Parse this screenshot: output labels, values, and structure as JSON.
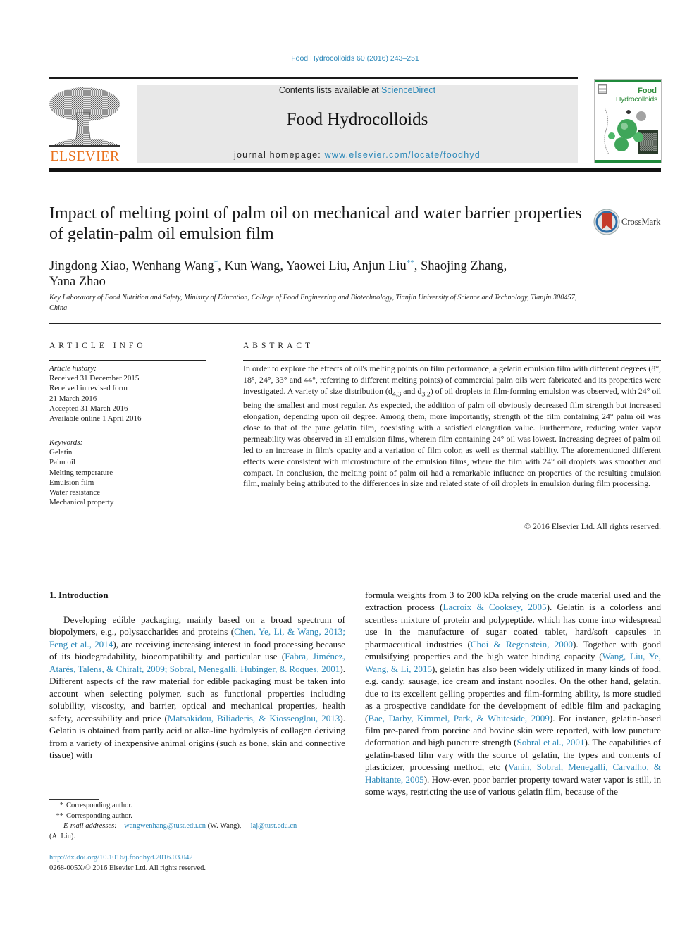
{
  "header": {
    "citation": "Food Hydrocolloids 60 (2016) 243–251",
    "contents_prefix": "Contents lists available at ",
    "contents_link": "ScienceDirect",
    "journal_title": "Food Hydrocolloids",
    "homepage_prefix": "journal homepage: ",
    "homepage_link": "www.elsevier.com/locate/foodhyd",
    "publisher_logo_text": "ELSEVIER",
    "cover_title_line1": "Food",
    "cover_title_line2": "Hydrocolloids",
    "crossmark_label": "CrossMark"
  },
  "article": {
    "title": "Impact of melting point of palm oil on mechanical and water barrier properties of gelatin-palm oil emulsion film",
    "authors": [
      {
        "name": "Jingdong Xiao",
        "mark": ""
      },
      {
        "name": "Wenhang Wang",
        "mark": "*"
      },
      {
        "name": "Kun Wang",
        "mark": ""
      },
      {
        "name": "Yaowei Liu",
        "mark": ""
      },
      {
        "name": "Anjun Liu",
        "mark": "**"
      },
      {
        "name": "Shaojing Zhang",
        "mark": ""
      },
      {
        "name": "Yana Zhao",
        "mark": ""
      }
    ],
    "affiliation": "Key Laboratory of Food Nutrition and Safety, Ministry of Education, College of Food Engineering and Biotechnology, Tianjin University of Science and Technology, Tianjin 300457, China"
  },
  "article_info": {
    "heading": "ARTICLE INFO",
    "history_label": "Article history:",
    "history": [
      "Received 31 December 2015",
      "Received in revised form",
      "21 March 2016",
      "Accepted 31 March 2016",
      "Available online 1 April 2016"
    ],
    "keywords_label": "Keywords:",
    "keywords": [
      "Gelatin",
      "Palm oil",
      "Melting temperature",
      "Emulsion film",
      "Water resistance",
      "Mechanical property"
    ]
  },
  "abstract": {
    "heading": "ABSTRACT",
    "text_part1": "In order to explore the effects of oil's melting points on film performance, a gelatin emulsion film with different degrees (8°, 18°, 24°, 33° and 44°, referring to different melting points) of commercial palm oils were fabricated and its properties were investigated. A variety of size distribution (d",
    "sub1": "4,3",
    "text_part2": " and d",
    "sub2": "3,2",
    "text_part3": ") of oil droplets in film-forming emulsion was observed, with 24° oil being the smallest and most regular. As expected, the addition of palm oil obviously decreased film strength but increased elongation, depending upon oil degree. Among them, more importantly, strength of the film containing 24° palm oil was close to that of the pure gelatin film, coexisting with a satisfied elongation value. Furthermore, reducing water vapor permeability was observed in all emulsion films, wherein film containing 24° oil was lowest. Increasing degrees of palm oil led to an increase in film's opacity and a variation of film color, as well as thermal stability. The aforementioned different effects were consistent with microstructure of the emulsion films, where the film with 24° oil droplets was smoother and compact. In conclusion, the melting point of palm oil had a remarkable influence on properties of the resulting emulsion film, mainly being attributed to the differences in size and related state of oil droplets in emulsion during film processing.",
    "copyright": "© 2016 Elsevier Ltd. All rights reserved."
  },
  "intro": {
    "heading": "1.  Introduction",
    "left": [
      {
        "t": "Developing edible packaging, mainly based on a broad spectrum of biopolymers, e.g., polysaccharides and proteins ("
      },
      {
        "l": "Chen, Ye, Li, & Wang, 2013; Feng et al., 2014"
      },
      {
        "t": "), are receiving increasing interest in food processing because of its biodegradability, biocompatibility and particular use ("
      },
      {
        "l": "Fabra, Jiménez, Atarés, Talens, & Chiralt, 2009; Sobral, Menegalli, Hubinger, & Roques, 2001"
      },
      {
        "t": "). Different aspects of the raw material for edible packaging must be taken into account when selecting polymer, such as functional properties including solubility, viscosity, and barrier, optical and mechanical properties, health safety, accessibility and price ("
      },
      {
        "l": "Matsakidou, Biliaderis, & Kiosseoglou, 2013"
      },
      {
        "t": "). Gelatin is obtained from partly acid or alka-line hydrolysis of collagen deriving from a variety of inexpensive animal origins (such as bone, skin and connective tissue) with"
      }
    ],
    "right": [
      {
        "t": "formula weights from 3 to 200 kDa relying on the crude material used and the extraction process ("
      },
      {
        "l": "Lacroix & Cooksey, 2005"
      },
      {
        "t": "). Gelatin is a colorless and scentless mixture of protein and polypeptide, which has come into widespread use in the manufacture of sugar coated tablet, hard/soft capsules in pharmaceutical industries ("
      },
      {
        "l": "Choi & Regenstein, 2000"
      },
      {
        "t": "). Together with good emulsifying properties and the high water binding capacity ("
      },
      {
        "l": "Wang, Liu, Ye, Wang, & Li, 2015"
      },
      {
        "t": "), gelatin has also been widely utilized in many kinds of food, e.g. candy, sausage, ice cream and instant noodles. On the other hand, gelatin, due to its excellent gelling properties and film-forming ability, is more studied as a prospective candidate for the development of edible film and packaging ("
      },
      {
        "l": "Bae, Darby, Kimmel, Park, & Whiteside, 2009"
      },
      {
        "t": "). For instance, gelatin-based film pre-pared from porcine and bovine skin were reported, with low puncture deformation and high puncture strength ("
      },
      {
        "l": "Sobral et al., 2001"
      },
      {
        "t": "). The capabilities of gelatin-based film vary with the source of gelatin, the types and contents of plasticizer, processing method, etc ("
      },
      {
        "l": "Vanin, Sobral, Menegalli, Carvalho, & Habitante, 2005"
      },
      {
        "t": "). How-ever, poor barrier property toward water vapor is still, in some ways, restricting the use of various gelatin film, because of the"
      }
    ]
  },
  "footnotes": {
    "fn1_mark": "*",
    "fn1_text": "Corresponding author.",
    "fn2_mark": "**",
    "fn2_text": "Corresponding author.",
    "email_label": "E-mail addresses:",
    "email1": "wangwenhang@tust.edu.cn",
    "email1_owner": " (W. Wang), ",
    "email2": "laj@tust.edu.cn",
    "email2_owner": " (A. Liu).",
    "doi": "http://dx.doi.org/10.1016/j.foodhyd.2016.03.042",
    "issn_line": "0268-005X/© 2016 Elsevier Ltd. All rights reserved."
  },
  "colors": {
    "link": "#2a87b8",
    "elsevier_orange": "#e9711c",
    "journal_green": "#2e8b3b",
    "masthead_gray": "#e8e8e8"
  }
}
